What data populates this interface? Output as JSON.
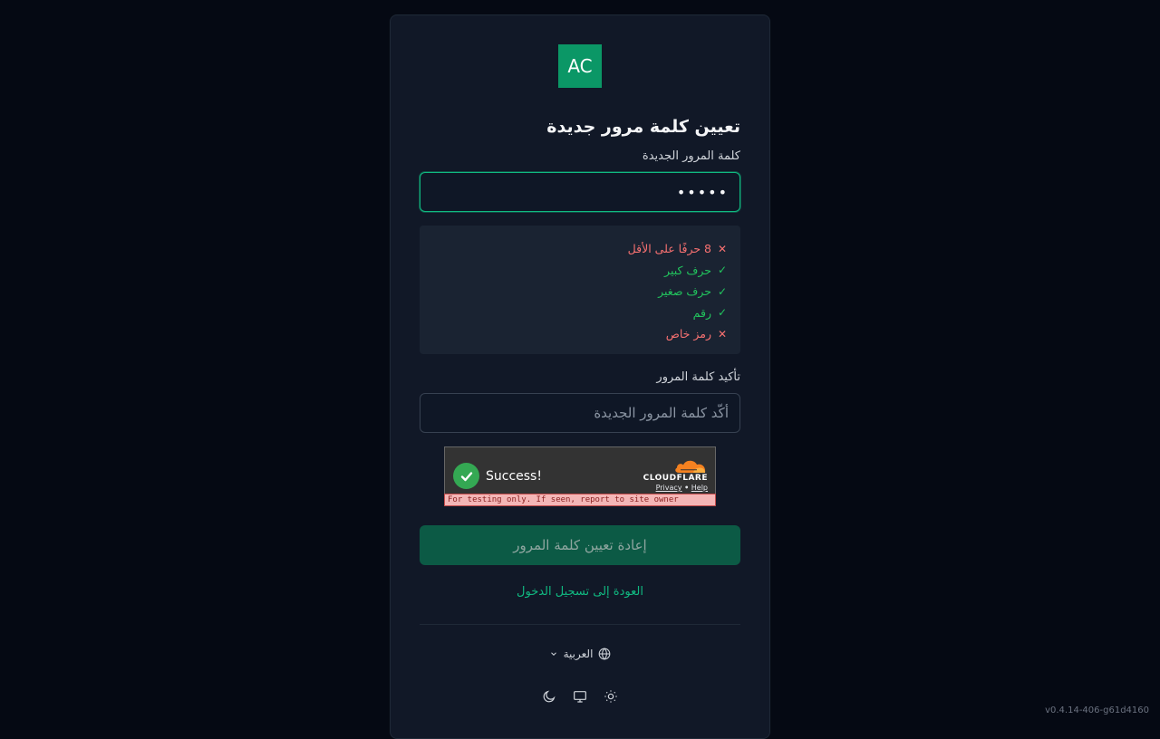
{
  "app": {
    "logo_text": "AC",
    "version": "v0.4.14-406-g61d4160"
  },
  "form": {
    "title": "تعيين كلمة مرور جديدة",
    "new_password_label": "كلمة المرور الجديدة",
    "new_password_value": "•••••",
    "confirm_label": "تأكيد كلمة المرور",
    "confirm_placeholder": "أكّد كلمة المرور الجديدة",
    "submit_label": "إعادة تعيين كلمة المرور",
    "back_link": "العودة إلى تسجيل الدخول"
  },
  "requirements": [
    {
      "label": "8 حرفًا على الأقل",
      "met": false
    },
    {
      "label": "حرف كبير",
      "met": true
    },
    {
      "label": "حرف صغير",
      "met": true
    },
    {
      "label": "رقم",
      "met": true
    },
    {
      "label": "رمز خاص",
      "met": false
    }
  ],
  "captcha": {
    "status": "Success!",
    "brand": "CLOUDFLARE",
    "privacy": "Privacy",
    "separator": "•",
    "help": "Help",
    "test_notice": "For testing only. If seen, report to site owner"
  },
  "footer": {
    "language": "العربية"
  },
  "colors": {
    "accent": "#10b981",
    "error": "#f87171",
    "success": "#22c55e"
  }
}
